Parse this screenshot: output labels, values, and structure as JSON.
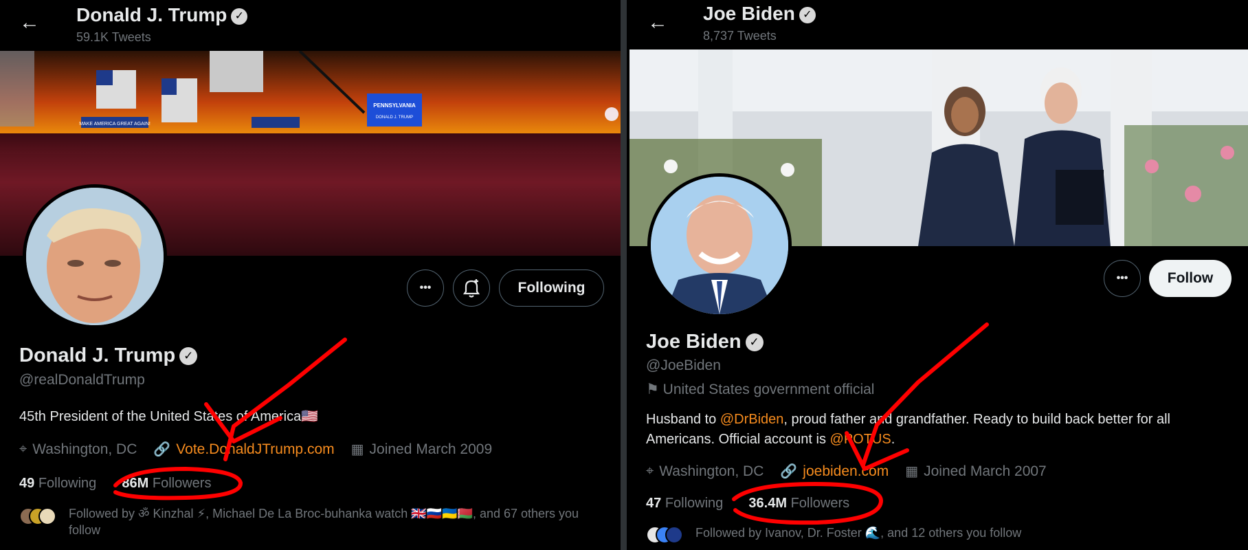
{
  "left": {
    "header": {
      "name": "Donald J. Trump",
      "tweets": "59.1K Tweets"
    },
    "banner": {
      "sign": "PENNSYLVANIA WELCOMES PRESIDENT DONALD J. TRUMP",
      "ribbon": "MAKE AMERICA GREAT AGAIN!"
    },
    "actions": {
      "more": "•••",
      "notify": "bell-plus",
      "follow_label": "Following"
    },
    "profile": {
      "name": "Donald J. Trump",
      "handle": "@realDonaldTrump",
      "bio": "45th President of the United States of America🇺🇸",
      "location": "Washington, DC",
      "website": "Vote.DonaldJTrump.com",
      "joined": "Joined March 2009"
    },
    "stats": {
      "following_count": "49",
      "following_label": "Following",
      "followers_count": "86M",
      "followers_label": "Followers"
    },
    "followed_by": "Followed by ॐ Kinzhal ⚡, Michael De La Broc-buhanka watch 🇬🇧🇷🇺🇺🇦🇧🇾, and 67 others you follow"
  },
  "right": {
    "header": {
      "name": "Joe Biden",
      "tweets": "8,737 Tweets"
    },
    "actions": {
      "more": "•••",
      "follow_label": "Follow"
    },
    "profile": {
      "name": "Joe Biden",
      "handle": "@JoeBiden",
      "label": "United States government official",
      "bio_pre": "Husband to ",
      "bio_link1": "@DrBiden",
      "bio_mid": ", proud father and grandfather. Ready to build back better for all Americans. Official account is ",
      "bio_link2": "@POTUS",
      "bio_post": ".",
      "location": "Washington, DC",
      "website": "joebiden.com",
      "joined": "Joined March 2007"
    },
    "stats": {
      "following_count": "47",
      "following_label": "Following",
      "followers_count": "36.4M",
      "followers_label": "Followers"
    },
    "followed_by": "Followed by Ivanov, Dr. Foster 🌊, and 12 others you follow"
  },
  "icons": {
    "back": "←",
    "verified": "✓",
    "location": "⌖",
    "link": "🔗",
    "calendar": "▦",
    "flag": "⚑"
  },
  "colors": {
    "link": "#f78c1e",
    "annotation": "#ff0000",
    "muted": "#71767b"
  }
}
